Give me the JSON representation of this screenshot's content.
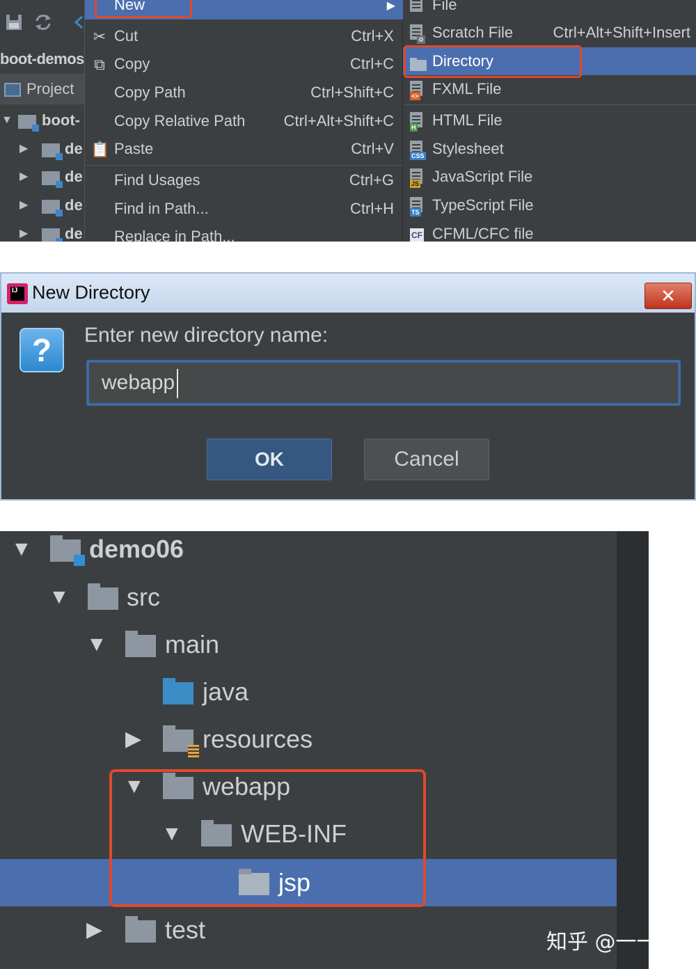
{
  "menu": {
    "new_label": "New",
    "items": [
      {
        "label": "Cut",
        "shortcut": "Ctrl+X",
        "icon": "scissors-icon"
      },
      {
        "label": "Copy",
        "shortcut": "Ctrl+C",
        "icon": "copy-icon"
      },
      {
        "label": "Copy Path",
        "shortcut": "Ctrl+Shift+C",
        "icon": ""
      },
      {
        "label": "Copy Relative Path",
        "shortcut": "Ctrl+Alt+Shift+C",
        "icon": ""
      },
      {
        "label": "Paste",
        "shortcut": "Ctrl+V",
        "icon": "paste-icon"
      },
      {
        "label": "Find Usages",
        "shortcut": "Ctrl+G",
        "icon": ""
      },
      {
        "label": "Find in Path...",
        "shortcut": "Ctrl+H",
        "icon": ""
      },
      {
        "label": "Replace in Path...",
        "shortcut": "",
        "icon": ""
      }
    ]
  },
  "submenu": {
    "items": [
      {
        "label": "File",
        "shortcut": "",
        "icon": "file-icon",
        "badge": ""
      },
      {
        "label": "Scratch File",
        "shortcut": "Ctrl+Alt+Shift+Insert",
        "icon": "scratch-file-icon",
        "badge": ""
      },
      {
        "label": "Directory",
        "shortcut": "",
        "icon": "folder-icon",
        "badge": ""
      },
      {
        "label": "FXML File",
        "shortcut": "",
        "icon": "fxml-file-icon",
        "badge": "<>"
      },
      {
        "label": "HTML File",
        "shortcut": "",
        "icon": "html-file-icon",
        "badge": "H"
      },
      {
        "label": "Stylesheet",
        "shortcut": "",
        "icon": "css-file-icon",
        "badge": "CSS"
      },
      {
        "label": "JavaScript File",
        "shortcut": "",
        "icon": "js-file-icon",
        "badge": "JS"
      },
      {
        "label": "TypeScript File",
        "shortcut": "",
        "icon": "ts-file-icon",
        "badge": "TS"
      },
      {
        "label": "CFML/CFC file",
        "shortcut": "",
        "icon": "cfml-file-icon",
        "badge": "CF"
      }
    ]
  },
  "left_panel": {
    "breadcrumb": "boot-demos",
    "project_tab": "Project",
    "tree": [
      {
        "label": "boot-"
      },
      {
        "label": "de"
      },
      {
        "label": "de"
      },
      {
        "label": "de"
      },
      {
        "label": "de"
      }
    ]
  },
  "dialog": {
    "title": "New Directory",
    "logo": "IJ",
    "close_glyph": "✕",
    "help_glyph": "?",
    "prompt": "Enter new directory name:",
    "input_value": "webapp",
    "ok_label": "OK",
    "cancel_label": "Cancel"
  },
  "project_tree": {
    "rows": [
      {
        "label": "demo06"
      },
      {
        "label": "src"
      },
      {
        "label": "main"
      },
      {
        "label": "java"
      },
      {
        "label": "resources"
      },
      {
        "label": "webapp"
      },
      {
        "label": "WEB-INF"
      },
      {
        "label": "jsp"
      },
      {
        "label": "test"
      }
    ]
  },
  "watermark": "知乎 @一一哥",
  "colors": {
    "background": "#3c3f41",
    "selection": "#4b6eaf",
    "highlight_box": "#e0492c",
    "ok_button": "#365880"
  }
}
